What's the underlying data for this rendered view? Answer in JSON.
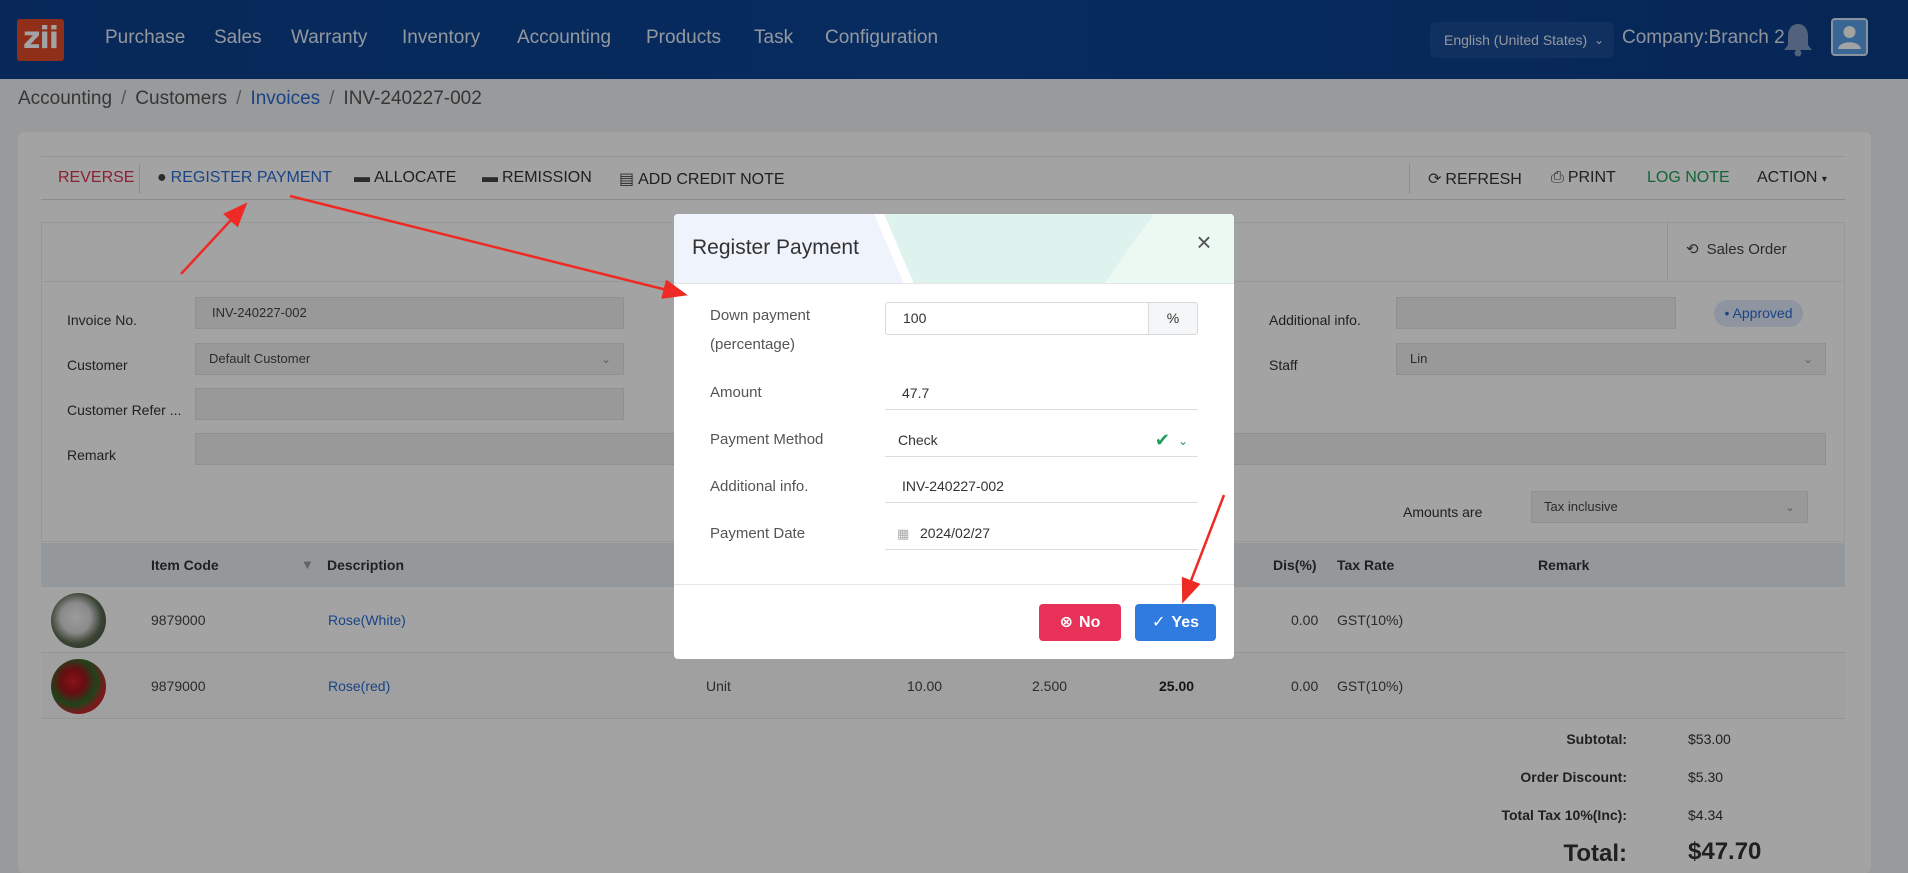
{
  "nav": {
    "logo_text": "zii",
    "items": [
      "Purchase",
      "Sales",
      "Warranty",
      "Inventory",
      "Accounting",
      "Products",
      "Task",
      "Configuration"
    ],
    "language": "English (United States)",
    "company": "Company:Branch 2"
  },
  "breadcrumb": {
    "items": [
      "Accounting",
      "Customers",
      "Invoices",
      "INV-240227-002"
    ]
  },
  "toolbar": {
    "reverse": "REVERSE",
    "register_payment": "REGISTER PAYMENT",
    "allocate": "ALLOCATE",
    "remission": "REMISSION",
    "add_credit_note": "ADD CREDIT NOTE",
    "refresh": "REFRESH",
    "print": "PRINT",
    "log_note": "LOG NOTE",
    "action": "ACTION"
  },
  "sales_order": "Sales Order",
  "form": {
    "invoice_no_label": "Invoice No.",
    "invoice_no": "INV-240227-002",
    "customer_label": "Customer",
    "customer": "Default Customer",
    "customer_ref_label": "Customer Refer ...",
    "remark_label": "Remark",
    "additional_info_label": "Additional info.",
    "status": "Approved",
    "staff_label": "Staff",
    "staff": "Lin",
    "amounts_are_label": "Amounts are",
    "amounts_are": "Tax inclusive"
  },
  "table": {
    "headers": {
      "item_code": "Item Code",
      "description": "Description",
      "dis": "Dis(%)",
      "tax_rate": "Tax Rate",
      "remark": "Remark"
    },
    "rows": [
      {
        "code": "9879000",
        "description": "Rose(White)",
        "unit": "",
        "qty": "",
        "price": "",
        "total": "",
        "dis": "0.00",
        "tax": "GST(10%)"
      },
      {
        "code": "9879000",
        "description": "Rose(red)",
        "unit": "Unit",
        "qty": "10.00",
        "price": "2.500",
        "total": "25.00",
        "dis": "0.00",
        "tax": "GST(10%)"
      }
    ]
  },
  "totals": {
    "subtotal_label": "Subtotal:",
    "subtotal": "$53.00",
    "discount_label": "Order Discount:",
    "discount": "$5.30",
    "tax_label": "Total Tax 10%(Inc):",
    "tax": "$4.34",
    "total_label": "Total:",
    "total": "$47.70"
  },
  "modal": {
    "title": "Register Payment",
    "down_payment_label": "Down payment (percentage)",
    "down_payment": "100",
    "percent_symbol": "%",
    "amount_label": "Amount",
    "amount": "47.7",
    "payment_method_label": "Payment Method",
    "payment_method": "Check",
    "additional_info_label": "Additional info.",
    "additional_info": "INV-240227-002",
    "payment_date_label": "Payment Date",
    "payment_date": "2024/02/27",
    "no_label": "No",
    "yes_label": "Yes"
  },
  "colors": {
    "nav_bg": "#0c4596",
    "primary": "#2a6bd1",
    "danger": "#e8325a",
    "success": "#1e9e57",
    "arrow": "#ee2a24"
  }
}
